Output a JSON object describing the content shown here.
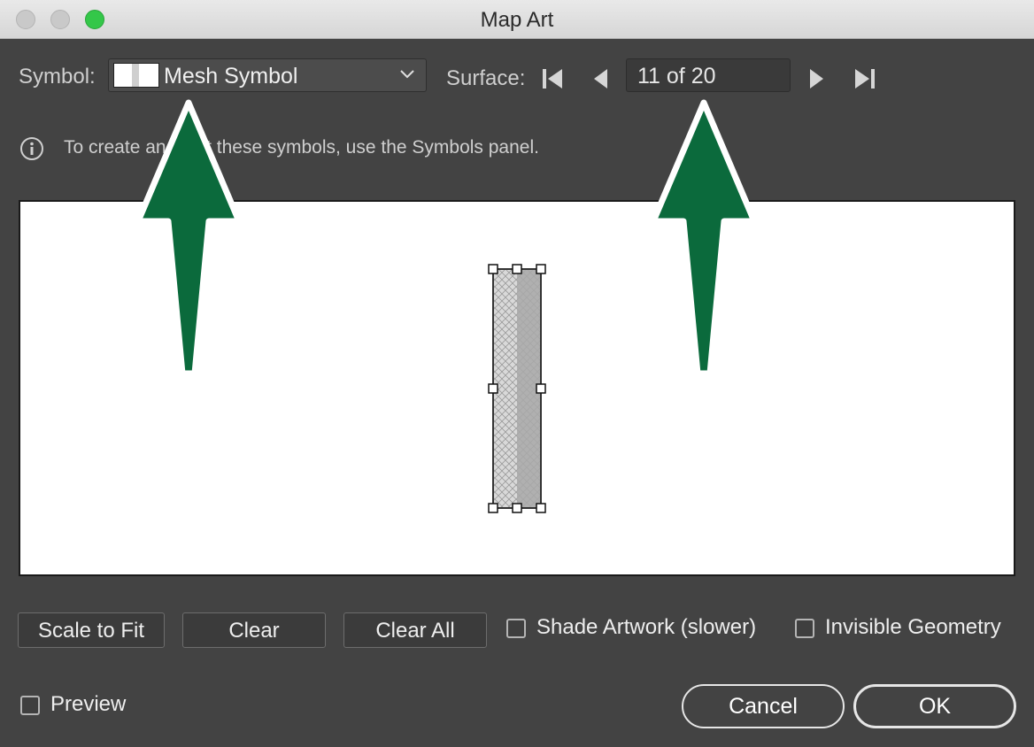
{
  "window": {
    "title": "Map Art",
    "controls": [
      "close",
      "minimize",
      "zoom"
    ]
  },
  "symbol": {
    "label": "Symbol:",
    "selected": "Mesh Symbol",
    "icon": "chevron-down-icon"
  },
  "surface": {
    "label": "Surface:",
    "value": "11 of 20",
    "nav_icons": [
      "first-icon",
      "prev-icon",
      "next-icon",
      "last-icon"
    ]
  },
  "info": {
    "icon": "info-icon",
    "text": "To create and edit these symbols, use the Symbols panel."
  },
  "buttons": {
    "scale_to_fit": "Scale to Fit",
    "clear": "Clear",
    "clear_all": "Clear All",
    "cancel": "Cancel",
    "ok": "OK"
  },
  "options": {
    "shade_artwork": {
      "label": "Shade Artwork (slower)",
      "checked": false
    },
    "invisible_geometry": {
      "label": "Invisible Geometry",
      "checked": false
    },
    "preview": {
      "label": "Preview",
      "checked": false
    }
  },
  "colors": {
    "dialog_bg": "#434343",
    "annotation_arrow": "#0b6a3c",
    "zoom_button": "#34c749"
  }
}
